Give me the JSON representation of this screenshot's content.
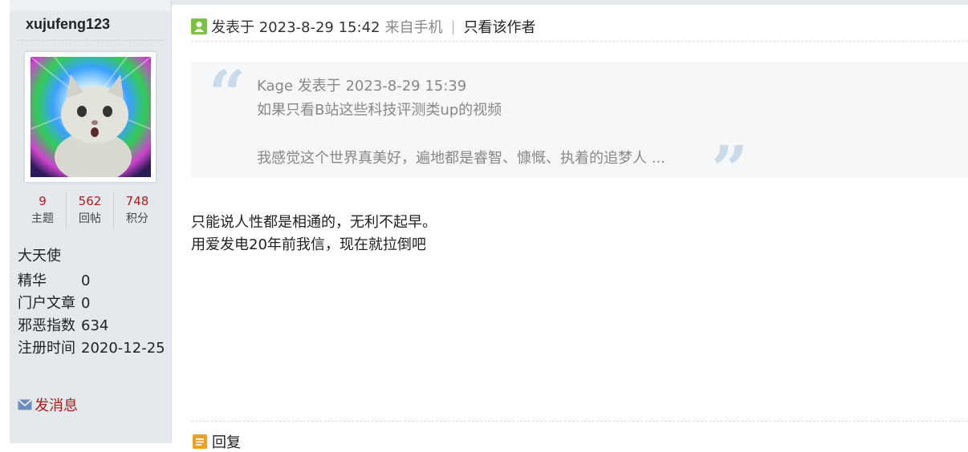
{
  "sidebar": {
    "username": "xujufeng123",
    "stats": [
      {
        "value": "9",
        "label": "主题"
      },
      {
        "value": "562",
        "label": "回帖"
      },
      {
        "value": "748",
        "label": "积分"
      }
    ],
    "rank": "大天使",
    "info": [
      {
        "key": "精华",
        "value": "0"
      },
      {
        "key": "门户文章",
        "value": "0"
      },
      {
        "key": "邪恶指数",
        "value": "634"
      },
      {
        "key": "注册时间",
        "value": "2020-12-25"
      }
    ],
    "send_message": "发消息"
  },
  "post": {
    "posted_at": "发表于 2023-8-29 15:42",
    "source": "来自手机",
    "separator": "|",
    "only_author": "只看该作者"
  },
  "quote": {
    "meta": "Kage 发表于 2023-8-29 15:39",
    "line1": "如果只看B站这些科技评测类up的视频",
    "line2": "我感觉这个世界真美好，遍地都是睿智、慷慨、执着的追梦人 ..."
  },
  "body": {
    "line1": "只能说人性都是相通的，无利不起早。",
    "line2": "用爱发电20年前我信，现在就拉倒吧"
  },
  "actions": {
    "reply": "回复"
  },
  "colors": {
    "sidebar_bg": "#e5e9ee",
    "stat_number": "#b01c1c",
    "link_red": "#b01c1c",
    "quote_bg": "#f5f7f9",
    "quote_mark": "#c9daeb",
    "author_icon": "#7cc242",
    "reply_icon": "#f0a020"
  }
}
